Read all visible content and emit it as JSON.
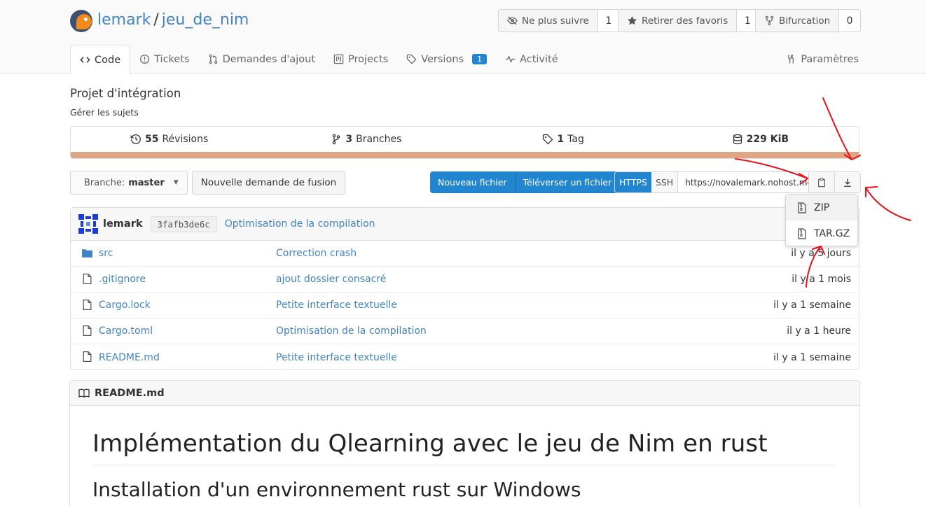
{
  "repo": {
    "owner": "lemark",
    "separator": "/",
    "name": "jeu_de_nim"
  },
  "header_buttons": {
    "watch": {
      "label": "Ne plus suivre",
      "count": "1",
      "icon": "eye-slash-icon"
    },
    "star": {
      "label": "Retirer des favoris",
      "count": "1",
      "icon": "star-icon"
    },
    "fork": {
      "label": "Bifurcation",
      "count": "0",
      "icon": "fork-icon"
    }
  },
  "tabs": [
    {
      "label": "Code",
      "icon": "code-icon",
      "active": true
    },
    {
      "label": "Tickets",
      "icon": "issue-icon"
    },
    {
      "label": "Demandes d'ajout",
      "icon": "pull-request-icon"
    },
    {
      "label": "Projects",
      "icon": "project-icon"
    },
    {
      "label": "Versions",
      "icon": "tag-icon",
      "badge": "1"
    },
    {
      "label": "Activité",
      "icon": "pulse-icon"
    }
  ],
  "settings_tab": {
    "label": "Paramètres",
    "icon": "tools-icon"
  },
  "project": {
    "title": "Projet d'intégration",
    "description": "Gérer les sujets"
  },
  "stats": {
    "commits": {
      "count": "55",
      "label": "Révisions"
    },
    "branches": {
      "count": "3",
      "label": "Branches"
    },
    "tags": {
      "count": "1",
      "label": "Tag"
    },
    "size": {
      "value": "229 KiB"
    }
  },
  "language_bar": {
    "color": "#dea584",
    "percent": 100
  },
  "branch_selector": {
    "prefix": "Branche:",
    "branch": "master"
  },
  "new_pr_button": "Nouvelle demande de fusion",
  "file_buttons": {
    "new_file": "Nouveau fichier",
    "upload": "Téléverser un fichier"
  },
  "clone": {
    "https": "HTTPS",
    "ssh": "SSH",
    "url": "https://novalemark.nohost.me/gitea/lemark/jeu_de_nim.git"
  },
  "download_menu": {
    "items": [
      "ZIP",
      "TAR.GZ"
    ]
  },
  "latest_commit": {
    "author": "lemark",
    "sha": "3fafb3de6c",
    "message": "Optimisation de la compilation"
  },
  "files": [
    {
      "name": "src",
      "type": "folder",
      "message": "Correction crash",
      "age": "il y a 5 jours"
    },
    {
      "name": ".gitignore",
      "type": "file",
      "message": "ajout dossier consacré",
      "age": "il y a 1 mois"
    },
    {
      "name": "Cargo.lock",
      "type": "file",
      "message": "Petite interface textuelle",
      "age": "il y a 1 semaine"
    },
    {
      "name": "Cargo.toml",
      "type": "file",
      "message": "Optimisation de la compilation",
      "age": "il y a 1 heure"
    },
    {
      "name": "README.md",
      "type": "file",
      "message": "Petite interface textuelle",
      "age": "il y a 1 semaine"
    }
  ],
  "readme": {
    "filename": "README.md",
    "h1": "Implémentation du Qlearning avec le jeu de Nim en rust",
    "h2": "Installation d'un environnement rust sur Windows"
  },
  "colors": {
    "link": "#4183c4",
    "primary": "#2185d0",
    "annotation": "#e8101a"
  }
}
